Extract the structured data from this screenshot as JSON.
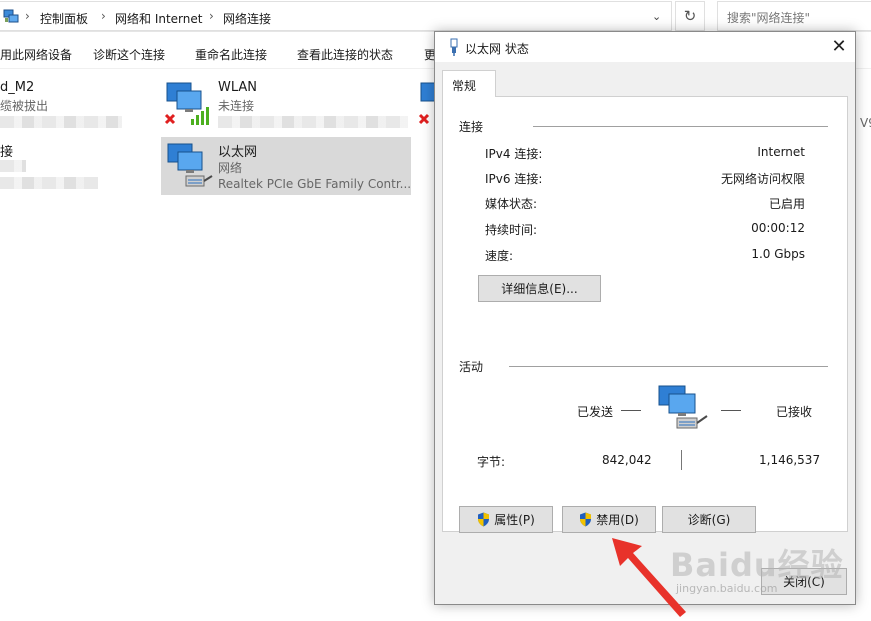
{
  "address_bar": {
    "crumbs": [
      "控制面板",
      "网络和 Internet",
      "网络连接"
    ],
    "search_placeholder": "搜索\"网络连接\""
  },
  "command_bar": {
    "items": [
      "用此网络设备",
      "诊断这个连接",
      "重命名此连接",
      "查看此连接的状态",
      "更"
    ]
  },
  "adapters": [
    {
      "name": "d_M2",
      "status": "缆被拔出"
    },
    {
      "name": "WLAN",
      "status": "未连接"
    },
    {
      "name": "接",
      "status": ""
    },
    {
      "name": "以太网",
      "status": "网络",
      "device": "Realtek PCIe GbE Family Contr..."
    }
  ],
  "right_edge_text": "V9",
  "dialog": {
    "title": "以太网 状态",
    "tab": "常规",
    "connection_group": "连接",
    "rows": [
      {
        "label": "IPv4 连接:",
        "value": "Internet"
      },
      {
        "label": "IPv6 连接:",
        "value": "无网络访问权限"
      },
      {
        "label": "媒体状态:",
        "value": "已启用"
      },
      {
        "label": "持续时间:",
        "value": "00:00:12"
      },
      {
        "label": "速度:",
        "value": "1.0 Gbps"
      }
    ],
    "details_button": "详细信息(E)...",
    "activity_group": "活动",
    "sent_label": "已发送",
    "received_label": "已接收",
    "bytes_label": "字节:",
    "bytes_sent": "842,042",
    "bytes_received": "1,146,537",
    "properties_button": "属性(P)",
    "disable_button": "禁用(D)",
    "diagnose_button": "诊断(G)",
    "close_button": "关闭(C)"
  },
  "watermark": {
    "text": "Baidu经验",
    "url": "jingyan.baidu.com"
  },
  "colors": {
    "accent_arrow": "#e8322a",
    "selection": "#d9d9d9",
    "dialog_bg": "#f0f0f0",
    "shield_blue": "#1f5fbf",
    "shield_yellow": "#f2c200"
  }
}
